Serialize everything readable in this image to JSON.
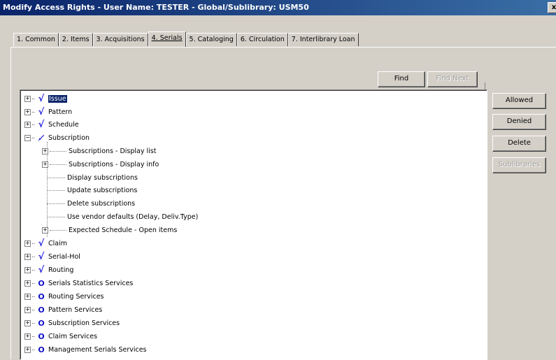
{
  "window": {
    "title": "Modify Access Rights - User Name: TESTER - Global/Sublibrary: USM50",
    "close_glyph": "x"
  },
  "tabs": [
    {
      "label": "1. Common"
    },
    {
      "label": "2. Items"
    },
    {
      "label": "3. Acquisitions"
    },
    {
      "label": "4. Serials"
    },
    {
      "label": "5. Cataloging"
    },
    {
      "label": "6. Circulation"
    },
    {
      "label": "7. Interlibrary Loan"
    }
  ],
  "find": {
    "find_label": "Find",
    "find_next_label": "Find Next"
  },
  "side_buttons": {
    "allowed": "Allowed",
    "denied": "Denied",
    "delete": "Delete",
    "sublibraries": "Sublibraries"
  },
  "glyphs": {
    "check": "√",
    "partial": "✓̸",
    "circle": "O",
    "plus": "+",
    "minus": "−"
  },
  "tree": {
    "top": [
      {
        "label": "Issue",
        "icon": "check"
      },
      {
        "label": "Pattern",
        "icon": "check"
      },
      {
        "label": "Schedule",
        "icon": "check"
      },
      {
        "label": "Subscription",
        "icon": "partial"
      }
    ],
    "children": [
      {
        "label": "Subscriptions - Display list",
        "expandable": true
      },
      {
        "label": "Subscriptions - Display info",
        "expandable": true
      },
      {
        "label": "Display subscriptions",
        "expandable": false
      },
      {
        "label": "Update subscriptions",
        "expandable": false
      },
      {
        "label": "Delete subscriptions",
        "expandable": false
      },
      {
        "label": "Use vendor defaults (Delay, Deliv.Type)",
        "expandable": false
      },
      {
        "label": "Expected Schedule - Open items",
        "expandable": true
      }
    ],
    "bottom": [
      {
        "label": "Claim",
        "icon": "check"
      },
      {
        "label": "Serial-Hol",
        "icon": "check"
      },
      {
        "label": "Routing",
        "icon": "check"
      },
      {
        "label": "Serials Statistics Services",
        "icon": "circle"
      },
      {
        "label": "Routing Services",
        "icon": "circle"
      },
      {
        "label": "Pattern Services",
        "icon": "circle"
      },
      {
        "label": "Subscription Services",
        "icon": "circle"
      },
      {
        "label": "Claim Services",
        "icon": "circle"
      },
      {
        "label": "Management Serials Services",
        "icon": "circle"
      }
    ]
  }
}
